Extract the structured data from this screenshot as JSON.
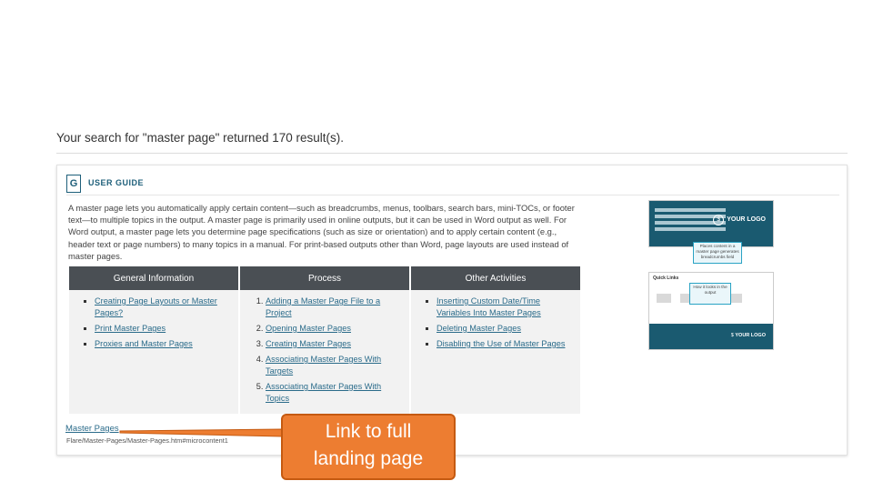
{
  "search": {
    "summary": "Your search for \"master page\" returned 170 result(s)."
  },
  "result": {
    "badge": "G",
    "category": "USER GUIDE",
    "description": "A master page lets you automatically apply certain content—such as breadcrumbs, menus, toolbars, search bars, mini-TOCs, or footer text—to multiple topics in the output. A master page is primarily used in online outputs, but it can be used in Word output as well. For Word output, a master page lets you determine page specifications (such as size or orientation) and to apply certain content (e.g., header text or page numbers) to many topics in a manual. For print-based outputs other than Word, page layouts are used instead of master pages.",
    "columns": [
      {
        "header": "General Information",
        "items": [
          "Creating Page Layouts or Master Pages?",
          "Print Master Pages",
          "Proxies and Master Pages"
        ]
      },
      {
        "header": "Process",
        "items": [
          "Adding a Master Page File to a Project",
          "Opening Master Pages",
          "Creating Master Pages",
          "Associating Master Pages With Targets",
          "Associating Master Pages With Topics"
        ]
      },
      {
        "header": "Other Activities",
        "items": [
          "Inserting Custom Date/Time Variables Into Master Pages",
          "Deleting Master Pages",
          "Disabling the Use of Master Pages"
        ]
      }
    ],
    "link": "Master Pages",
    "path": "Flare/Master-Pages/Master-Pages.htm#microcontent1",
    "thumb1_logo": "YOUR LOGO",
    "thumb1_callout": "Places content in a master page generates breadcrumbs field",
    "thumb2_title": "Quick Links",
    "thumb2_callout": "How it looks in the output",
    "thumb2_logo": "YOUR LOGO"
  },
  "annotation": {
    "text_line1": "Link to full",
    "text_line2": "landing page",
    "color": "#ed7d31"
  }
}
